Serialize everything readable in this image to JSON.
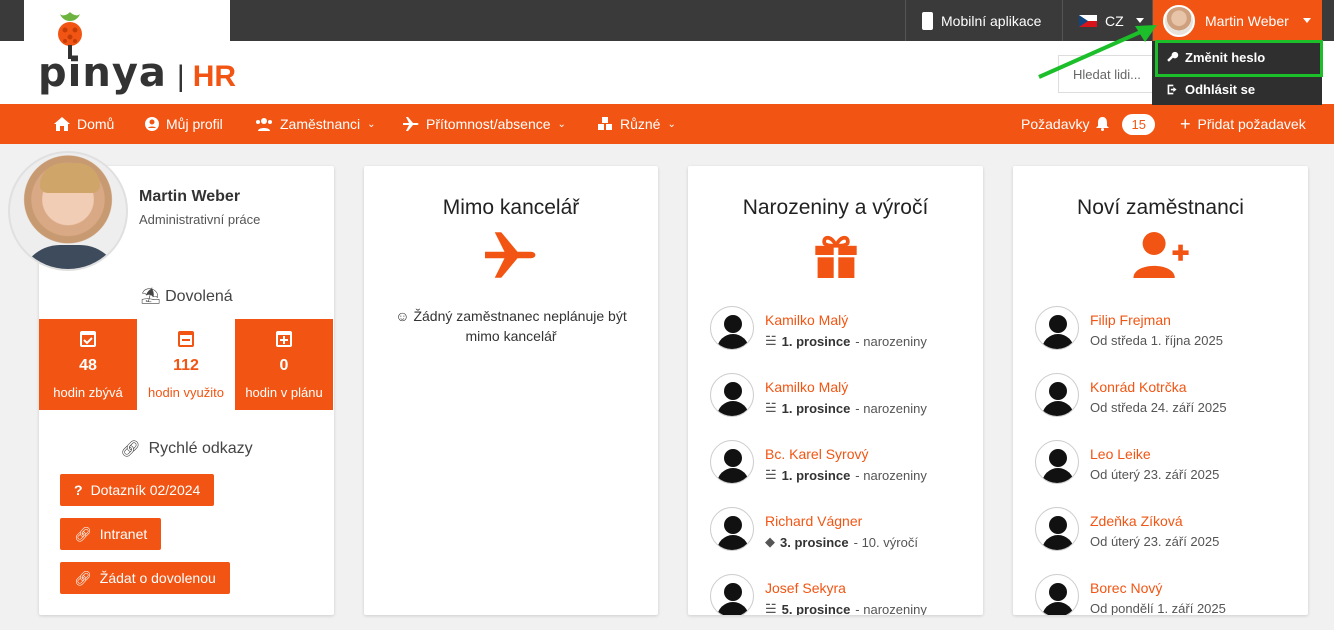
{
  "topbar": {
    "mobile_app": "Mobilní aplikace",
    "language": "CZ",
    "user_name": "Martin Weber"
  },
  "logo": {
    "word": "pinya",
    "separator": "|",
    "suffix": "HR"
  },
  "search": {
    "placeholder": "Hledat lidi..."
  },
  "user_menu": {
    "change_password": "Změnit heslo",
    "logout": "Odhlásit se"
  },
  "nav": {
    "home": "Domů",
    "profile": "Můj profil",
    "employees": "Zaměstnanci",
    "attendance": "Přítomnost/absence",
    "misc": "Různé",
    "requests": "Požadavky",
    "requests_count": "15",
    "add_request": "Přidat požadavek"
  },
  "profile": {
    "name": "Martin Weber",
    "role": "Administrativní práce",
    "vacation_title": "Dovolená",
    "stats": [
      {
        "value": "48",
        "label": "hodin zbývá"
      },
      {
        "value": "112",
        "label": "hodin využito"
      },
      {
        "value": "0",
        "label": "hodin v plánu"
      }
    ],
    "quick_links_title": "Rychlé odkazy",
    "links": [
      "Dotazník 02/2024",
      "Intranet",
      "Žádat o dovolenou"
    ]
  },
  "office": {
    "title": "Mimo kancelář",
    "empty": "Žádný zaměstnanec neplánuje být mimo kancelář"
  },
  "birthdays": {
    "title": "Narozeniny a výročí",
    "items": [
      {
        "name": "Kamilko Malý",
        "date": "1. prosince",
        "kind": "- narozeniny"
      },
      {
        "name": "Kamilko Malý",
        "date": "1. prosince",
        "kind": "- narozeniny"
      },
      {
        "name": "Bc. Karel Syrový",
        "date": "1. prosince",
        "kind": "- narozeniny"
      },
      {
        "name": "Richard Vágner",
        "date": "3. prosince",
        "kind": "- 10. výročí"
      },
      {
        "name": "Josef Sekyra",
        "date": "5. prosince",
        "kind": "- narozeniny"
      }
    ]
  },
  "new_employees": {
    "title": "Noví zaměstnanci",
    "items": [
      {
        "name": "Filip Frejman",
        "since": "Od středa 1. října 2025"
      },
      {
        "name": "Konrád Kotrčka",
        "since": "Od středa 24. září 2025"
      },
      {
        "name": "Leo Leike",
        "since": "Od úterý 23. září 2025"
      },
      {
        "name": "Zdeňka Zíková",
        "since": "Od úterý 23. září 2025"
      },
      {
        "name": "Borec Nový",
        "since": "Od pondělí 1. září 2025"
      }
    ]
  },
  "colors": {
    "accent": "#f25513",
    "topbar": "#3a3a3a",
    "highlight": "#1cbf2a"
  }
}
